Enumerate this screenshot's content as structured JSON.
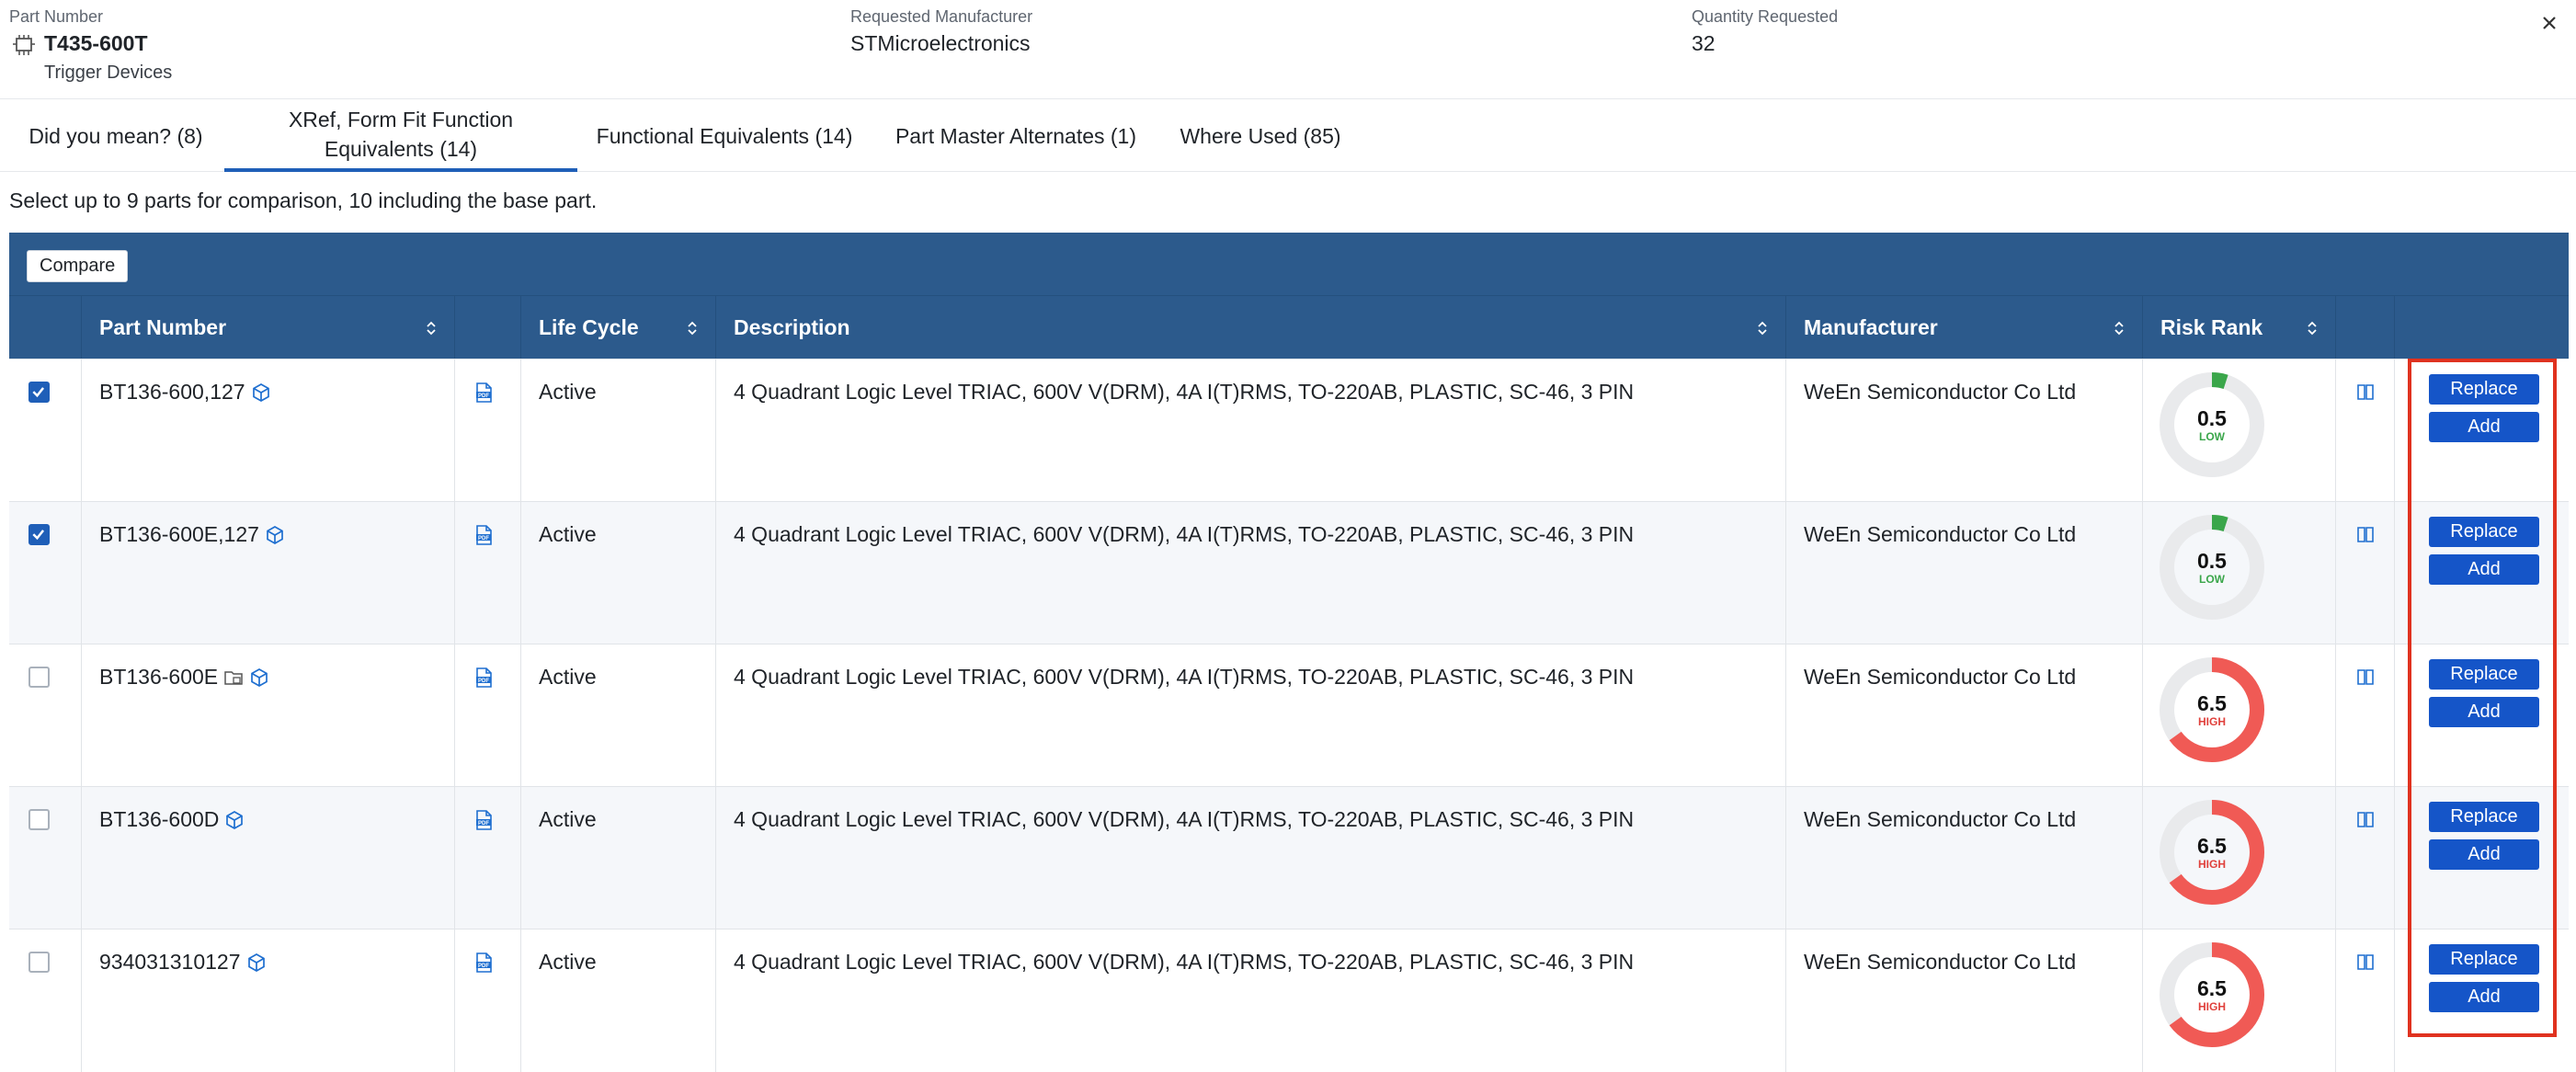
{
  "header": {
    "part_number_label": "Part Number",
    "part_number_value": "T435-600T",
    "part_number_sub": "Trigger Devices",
    "manufacturer_label": "Requested Manufacturer",
    "manufacturer_value": "STMicroelectronics",
    "quantity_label": "Quantity Requested",
    "quantity_value": "32"
  },
  "tabs": [
    {
      "label": "Did you mean? (8)",
      "active": false
    },
    {
      "label": "XRef, Form Fit Function Equivalents (14)",
      "active": true
    },
    {
      "label": "Functional Equivalents (14)",
      "active": false
    },
    {
      "label": "Part Master Alternates (1)",
      "active": false
    },
    {
      "label": "Where Used (85)",
      "active": false
    }
  ],
  "hint": "Select up to 9 parts for comparison, 10 including the base part.",
  "toolbar": {
    "compare_label": "Compare"
  },
  "columns": {
    "part_number": "Part Number",
    "life_cycle": "Life Cycle",
    "description": "Description",
    "manufacturer": "Manufacturer",
    "risk_rank": "Risk Rank"
  },
  "rows": [
    {
      "checked": true,
      "part_number": "BT136-600,127",
      "has_folder_icon": false,
      "life_cycle": "Active",
      "description": "4 Quadrant Logic Level TRIAC, 600V V(DRM), 4A I(T)RMS, TO-220AB, PLASTIC, SC-46, 3 PIN",
      "manufacturer": "WeEn Semiconductor Co Ltd",
      "risk_value": "0.5",
      "risk_level": "LOW",
      "risk_fraction": 0.05,
      "replace_label": "Replace",
      "add_label": "Add"
    },
    {
      "checked": true,
      "part_number": "BT136-600E,127",
      "has_folder_icon": false,
      "life_cycle": "Active",
      "description": "4 Quadrant Logic Level TRIAC, 600V V(DRM), 4A I(T)RMS, TO-220AB, PLASTIC, SC-46, 3 PIN",
      "manufacturer": "WeEn Semiconductor Co Ltd",
      "risk_value": "0.5",
      "risk_level": "LOW",
      "risk_fraction": 0.05,
      "replace_label": "Replace",
      "add_label": "Add"
    },
    {
      "checked": false,
      "part_number": "BT136-600E",
      "has_folder_icon": true,
      "life_cycle": "Active",
      "description": "4 Quadrant Logic Level TRIAC, 600V V(DRM), 4A I(T)RMS, TO-220AB, PLASTIC, SC-46, 3 PIN",
      "manufacturer": "WeEn Semiconductor Co Ltd",
      "risk_value": "6.5",
      "risk_level": "HIGH",
      "risk_fraction": 0.65,
      "replace_label": "Replace",
      "add_label": "Add"
    },
    {
      "checked": false,
      "part_number": "BT136-600D",
      "has_folder_icon": false,
      "life_cycle": "Active",
      "description": "4 Quadrant Logic Level TRIAC, 600V V(DRM), 4A I(T)RMS, TO-220AB, PLASTIC, SC-46, 3 PIN",
      "manufacturer": "WeEn Semiconductor Co Ltd",
      "risk_value": "6.5",
      "risk_level": "HIGH",
      "risk_fraction": 0.65,
      "replace_label": "Replace",
      "add_label": "Add"
    },
    {
      "checked": false,
      "part_number": "934031310127",
      "has_folder_icon": false,
      "life_cycle": "Active",
      "description": "4 Quadrant Logic Level TRIAC, 600V V(DRM), 4A I(T)RMS, TO-220AB, PLASTIC, SC-46, 3 PIN",
      "manufacturer": "WeEn Semiconductor Co Ltd",
      "risk_value": "6.5",
      "risk_level": "HIGH",
      "risk_fraction": 0.65,
      "replace_label": "Replace",
      "add_label": "Add"
    }
  ],
  "colors": {
    "accent": "#1555c8",
    "table_header": "#2c5a8c",
    "risk_low": "#3aa64a",
    "risk_high": "#f05a55",
    "highlight": "#e0321f"
  }
}
